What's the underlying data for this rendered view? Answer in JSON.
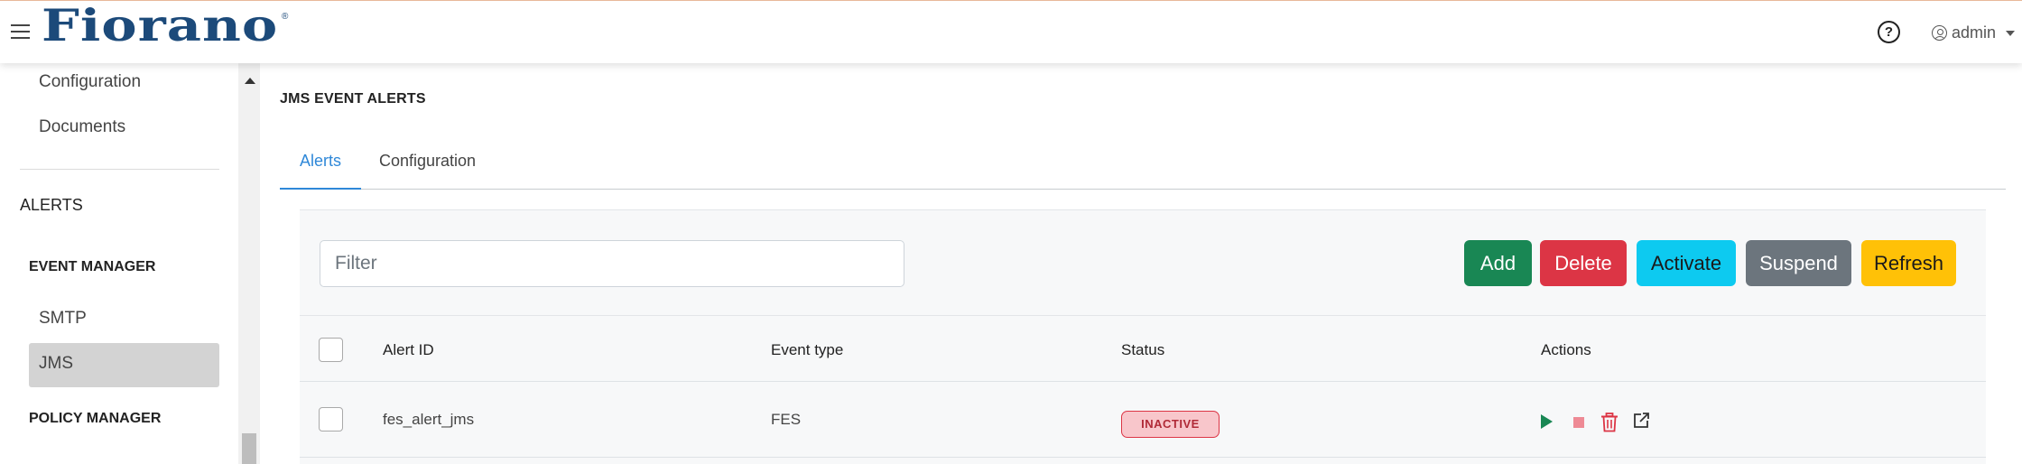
{
  "header": {
    "logo_text": "Fiorano",
    "logo_mark": "®",
    "help_symbol": "?",
    "user_label": "admin"
  },
  "sidebar": {
    "items": [
      {
        "label": "Configuration"
      },
      {
        "label": "Documents"
      }
    ],
    "section_alerts": "ALERTS",
    "event_manager": "EVENT MANAGER",
    "em_items": [
      {
        "label": "SMTP"
      },
      {
        "label": "JMS",
        "active": true
      }
    ],
    "policy_manager": "POLICY MANAGER"
  },
  "main": {
    "title": "JMS EVENT ALERTS",
    "tabs": [
      {
        "label": "Alerts",
        "active": true
      },
      {
        "label": "Configuration"
      }
    ],
    "filter_placeholder": "Filter",
    "buttons": {
      "add": "Add",
      "delete": "Delete",
      "activate": "Activate",
      "suspend": "Suspend",
      "refresh": "Refresh"
    },
    "table": {
      "columns": [
        "Alert ID",
        "Event type",
        "Status",
        "Actions"
      ],
      "rows": [
        {
          "alert_id": "fes_alert_jms",
          "event_type": "FES",
          "status": "INACTIVE",
          "actions": [
            "play-icon",
            "stop-icon",
            "trash-icon",
            "external-link-icon"
          ]
        }
      ]
    }
  },
  "colors": {
    "brand": "#1c4a7a",
    "link": "#2f88d8",
    "add": "#198754",
    "delete": "#dc3545",
    "activate": "#0dcaf0",
    "suspend": "#6c757d",
    "refresh": "#ffc107"
  }
}
